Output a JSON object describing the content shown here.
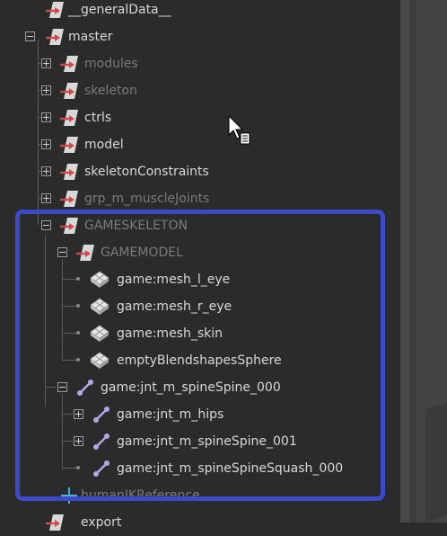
{
  "outliner": {
    "items": [
      {
        "label": "__generalData__"
      },
      {
        "label": "master"
      },
      {
        "label": "modules"
      },
      {
        "label": "skeleton"
      },
      {
        "label": "ctrls"
      },
      {
        "label": "model"
      },
      {
        "label": "skeletonConstraints"
      },
      {
        "label": "grp_m_muscleJoints"
      },
      {
        "label": "GAMESKELETON"
      },
      {
        "label": "GAMEMODEL"
      },
      {
        "label": "game:mesh_l_eye"
      },
      {
        "label": "game:mesh_r_eye"
      },
      {
        "label": "game:mesh_skin"
      },
      {
        "label": "emptyBlendshapesSphere"
      },
      {
        "label": "game:jnt_m_spineSpine_000"
      },
      {
        "label": "game:jnt_m_hips"
      },
      {
        "label": "game:jnt_m_spineSpine_001"
      },
      {
        "label": "game:jnt_m_spineSpineSquash_000"
      },
      {
        "label": "humanIKReference"
      },
      {
        "label": "export"
      }
    ]
  },
  "colors": {
    "background": "#2b2b2b",
    "highlight_border": "#3b4ac8",
    "text": "#d8d8d8",
    "dim_text": "#7b7b7b",
    "joint_icon": "#b4a3e6",
    "group_arrow": "#d94545"
  }
}
